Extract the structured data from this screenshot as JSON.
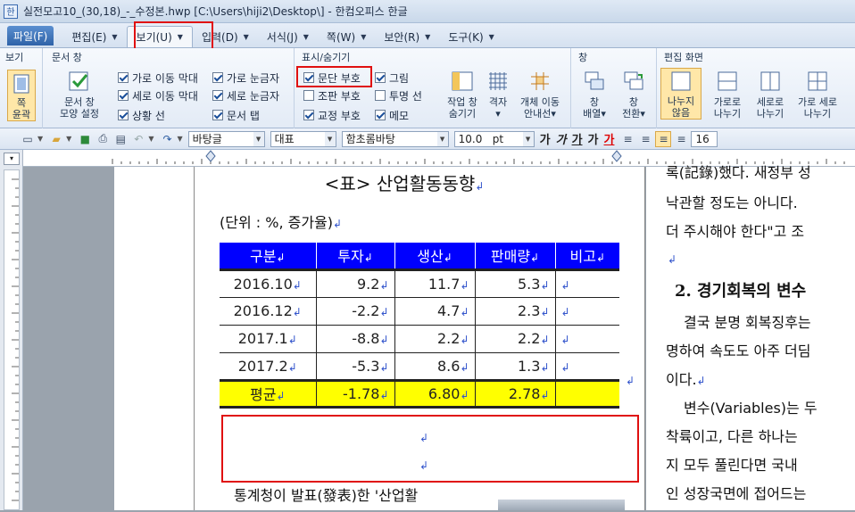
{
  "window": {
    "title": "실전모고10_(30,18)_-_수정본.hwp [C:\\Users\\hiji2\\Desktop\\] - 한컴오피스 한글"
  },
  "menu": {
    "file": "파일(F)",
    "tabs": [
      {
        "label": "편집(E)"
      },
      {
        "label": "보기(U)"
      },
      {
        "label": "입력(D)"
      },
      {
        "label": "서식(J)"
      },
      {
        "label": "쪽(W)"
      },
      {
        "label": "보안(R)"
      },
      {
        "label": "도구(K)"
      }
    ]
  },
  "ribbon": {
    "view": {
      "title": "보기",
      "btn": "쪽\n윤곽"
    },
    "docwin": {
      "title": "문서 창",
      "btn": "문서 창\n모양 설정"
    },
    "checks_a": [
      {
        "label": "가로 이동 막대",
        "checked": true
      },
      {
        "label": "세로 이동 막대",
        "checked": true
      },
      {
        "label": "상황 선",
        "checked": true
      }
    ],
    "checks_b": [
      {
        "label": "가로 눈금자",
        "checked": true
      },
      {
        "label": "세로 눈금자",
        "checked": true
      },
      {
        "label": "문서 탭",
        "checked": true
      }
    ],
    "showhide": {
      "title": "표시/숨기기"
    },
    "checks_c": [
      {
        "label": "문단 부호",
        "checked": true
      },
      {
        "label": "조판 부호",
        "checked": false
      },
      {
        "label": "교정 부호",
        "checked": true
      }
    ],
    "checks_d": [
      {
        "label": "그림",
        "checked": true
      },
      {
        "label": "투명 선",
        "checked": false
      },
      {
        "label": "메모",
        "checked": true
      }
    ],
    "big_sh": [
      {
        "label": "작업 창\n숨기기"
      },
      {
        "label": "격자\n▾"
      },
      {
        "label": "개체 이동\n안내선▾"
      }
    ],
    "win": {
      "title": "창",
      "btns": [
        {
          "label": "창\n배열▾"
        },
        {
          "label": "창\n전환▾"
        }
      ]
    },
    "editscreen": {
      "title": "편집 화면",
      "btns": [
        {
          "label": "나누지\n않음"
        },
        {
          "label": "가로로\n나누기"
        },
        {
          "label": "세로로\n나누기"
        },
        {
          "label": "가로 세로\n나누기"
        }
      ]
    }
  },
  "format": {
    "style": "바탕글",
    "lang": "대표",
    "font": "함초롬바탕",
    "size": "10.0",
    "unit": "pt",
    "size_right": "16"
  },
  "document": {
    "title": "<표> 산업활동동향",
    "unit": "(단위 : %, 증가율)",
    "headers": [
      "구분",
      "투자",
      "생산",
      "판매량",
      "비고"
    ],
    "rows": [
      [
        "2016.10",
        "9.2",
        "11.7",
        "5.3",
        ""
      ],
      [
        "2016.12",
        "-2.2",
        "4.7",
        "2.3",
        ""
      ],
      [
        "2017.1",
        "-8.8",
        "2.2",
        "2.2",
        ""
      ],
      [
        "2017.2",
        "-5.3",
        "8.6",
        "1.3",
        ""
      ]
    ],
    "avg": [
      "평균",
      "-1.78",
      "6.80",
      "2.78",
      ""
    ],
    "bottom_line": "통계청이 발표(發表)한 '산업활",
    "right_lines": [
      "록(記錄)했다. 새정부 성",
      "낙관할 정도는 아니다.",
      "더 주시해야 한다\"고 조",
      "결국 분명 회복징후는",
      "명하여 속도도 아주 더딤",
      "이다.",
      "변수(Variables)는 두",
      "착륙이고, 다른 하나는",
      "지 모두 풀린다면 국내",
      "인 성장국면에 접어드는"
    ],
    "right_heading": "2. 경기회복의 변수"
  }
}
